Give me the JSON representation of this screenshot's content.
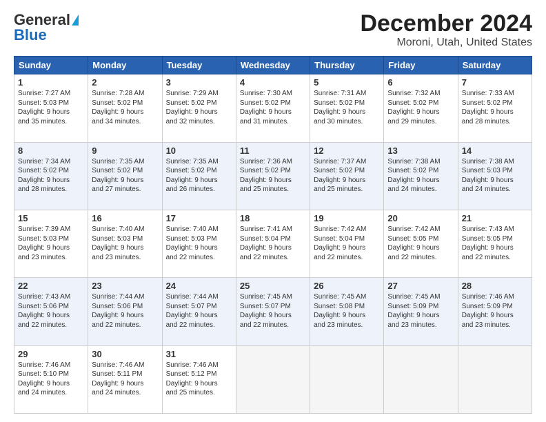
{
  "header": {
    "logo_general": "General",
    "logo_blue": "Blue",
    "title": "December 2024",
    "subtitle": "Moroni, Utah, United States"
  },
  "weekdays": [
    "Sunday",
    "Monday",
    "Tuesday",
    "Wednesday",
    "Thursday",
    "Friday",
    "Saturday"
  ],
  "weeks": [
    [
      {
        "day": "1",
        "lines": [
          "Sunrise: 7:27 AM",
          "Sunset: 5:03 PM",
          "Daylight: 9 hours",
          "and 35 minutes."
        ]
      },
      {
        "day": "2",
        "lines": [
          "Sunrise: 7:28 AM",
          "Sunset: 5:02 PM",
          "Daylight: 9 hours",
          "and 34 minutes."
        ]
      },
      {
        "day": "3",
        "lines": [
          "Sunrise: 7:29 AM",
          "Sunset: 5:02 PM",
          "Daylight: 9 hours",
          "and 32 minutes."
        ]
      },
      {
        "day": "4",
        "lines": [
          "Sunrise: 7:30 AM",
          "Sunset: 5:02 PM",
          "Daylight: 9 hours",
          "and 31 minutes."
        ]
      },
      {
        "day": "5",
        "lines": [
          "Sunrise: 7:31 AM",
          "Sunset: 5:02 PM",
          "Daylight: 9 hours",
          "and 30 minutes."
        ]
      },
      {
        "day": "6",
        "lines": [
          "Sunrise: 7:32 AM",
          "Sunset: 5:02 PM",
          "Daylight: 9 hours",
          "and 29 minutes."
        ]
      },
      {
        "day": "7",
        "lines": [
          "Sunrise: 7:33 AM",
          "Sunset: 5:02 PM",
          "Daylight: 9 hours",
          "and 28 minutes."
        ]
      }
    ],
    [
      {
        "day": "8",
        "lines": [
          "Sunrise: 7:34 AM",
          "Sunset: 5:02 PM",
          "Daylight: 9 hours",
          "and 28 minutes."
        ]
      },
      {
        "day": "9",
        "lines": [
          "Sunrise: 7:35 AM",
          "Sunset: 5:02 PM",
          "Daylight: 9 hours",
          "and 27 minutes."
        ]
      },
      {
        "day": "10",
        "lines": [
          "Sunrise: 7:35 AM",
          "Sunset: 5:02 PM",
          "Daylight: 9 hours",
          "and 26 minutes."
        ]
      },
      {
        "day": "11",
        "lines": [
          "Sunrise: 7:36 AM",
          "Sunset: 5:02 PM",
          "Daylight: 9 hours",
          "and 25 minutes."
        ]
      },
      {
        "day": "12",
        "lines": [
          "Sunrise: 7:37 AM",
          "Sunset: 5:02 PM",
          "Daylight: 9 hours",
          "and 25 minutes."
        ]
      },
      {
        "day": "13",
        "lines": [
          "Sunrise: 7:38 AM",
          "Sunset: 5:02 PM",
          "Daylight: 9 hours",
          "and 24 minutes."
        ]
      },
      {
        "day": "14",
        "lines": [
          "Sunrise: 7:38 AM",
          "Sunset: 5:03 PM",
          "Daylight: 9 hours",
          "and 24 minutes."
        ]
      }
    ],
    [
      {
        "day": "15",
        "lines": [
          "Sunrise: 7:39 AM",
          "Sunset: 5:03 PM",
          "Daylight: 9 hours",
          "and 23 minutes."
        ]
      },
      {
        "day": "16",
        "lines": [
          "Sunrise: 7:40 AM",
          "Sunset: 5:03 PM",
          "Daylight: 9 hours",
          "and 23 minutes."
        ]
      },
      {
        "day": "17",
        "lines": [
          "Sunrise: 7:40 AM",
          "Sunset: 5:03 PM",
          "Daylight: 9 hours",
          "and 22 minutes."
        ]
      },
      {
        "day": "18",
        "lines": [
          "Sunrise: 7:41 AM",
          "Sunset: 5:04 PM",
          "Daylight: 9 hours",
          "and 22 minutes."
        ]
      },
      {
        "day": "19",
        "lines": [
          "Sunrise: 7:42 AM",
          "Sunset: 5:04 PM",
          "Daylight: 9 hours",
          "and 22 minutes."
        ]
      },
      {
        "day": "20",
        "lines": [
          "Sunrise: 7:42 AM",
          "Sunset: 5:05 PM",
          "Daylight: 9 hours",
          "and 22 minutes."
        ]
      },
      {
        "day": "21",
        "lines": [
          "Sunrise: 7:43 AM",
          "Sunset: 5:05 PM",
          "Daylight: 9 hours",
          "and 22 minutes."
        ]
      }
    ],
    [
      {
        "day": "22",
        "lines": [
          "Sunrise: 7:43 AM",
          "Sunset: 5:06 PM",
          "Daylight: 9 hours",
          "and 22 minutes."
        ]
      },
      {
        "day": "23",
        "lines": [
          "Sunrise: 7:44 AM",
          "Sunset: 5:06 PM",
          "Daylight: 9 hours",
          "and 22 minutes."
        ]
      },
      {
        "day": "24",
        "lines": [
          "Sunrise: 7:44 AM",
          "Sunset: 5:07 PM",
          "Daylight: 9 hours",
          "and 22 minutes."
        ]
      },
      {
        "day": "25",
        "lines": [
          "Sunrise: 7:45 AM",
          "Sunset: 5:07 PM",
          "Daylight: 9 hours",
          "and 22 minutes."
        ]
      },
      {
        "day": "26",
        "lines": [
          "Sunrise: 7:45 AM",
          "Sunset: 5:08 PM",
          "Daylight: 9 hours",
          "and 23 minutes."
        ]
      },
      {
        "day": "27",
        "lines": [
          "Sunrise: 7:45 AM",
          "Sunset: 5:09 PM",
          "Daylight: 9 hours",
          "and 23 minutes."
        ]
      },
      {
        "day": "28",
        "lines": [
          "Sunrise: 7:46 AM",
          "Sunset: 5:09 PM",
          "Daylight: 9 hours",
          "and 23 minutes."
        ]
      }
    ],
    [
      {
        "day": "29",
        "lines": [
          "Sunrise: 7:46 AM",
          "Sunset: 5:10 PM",
          "Daylight: 9 hours",
          "and 24 minutes."
        ]
      },
      {
        "day": "30",
        "lines": [
          "Sunrise: 7:46 AM",
          "Sunset: 5:11 PM",
          "Daylight: 9 hours",
          "and 24 minutes."
        ]
      },
      {
        "day": "31",
        "lines": [
          "Sunrise: 7:46 AM",
          "Sunset: 5:12 PM",
          "Daylight: 9 hours",
          "and 25 minutes."
        ]
      },
      null,
      null,
      null,
      null
    ]
  ]
}
